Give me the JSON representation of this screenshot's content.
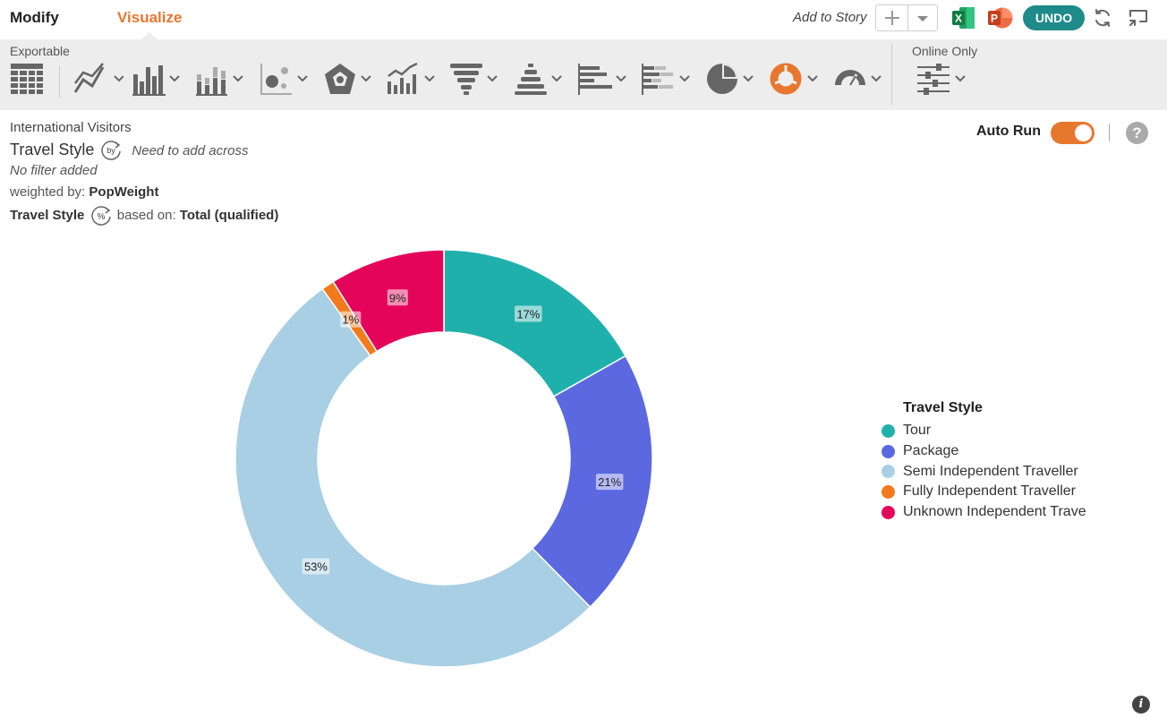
{
  "topbar": {
    "tabs": [
      "Modify",
      "Visualize"
    ],
    "add_to_story": "Add to Story",
    "undo": "UNDO",
    "excel_letter": "X",
    "ppt_letter": "P"
  },
  "toolbar": {
    "exportable_label": "Exportable",
    "online_only_label": "Online Only",
    "icons": [
      "table-icon",
      "line-chart-icon",
      "bar-chart-icon",
      "stacked-bar-icon",
      "scatter-icon",
      "radar-icon",
      "combo-chart-icon",
      "funnel-icon",
      "pyramid-icon",
      "horizontal-bar-icon",
      "horizontal-stacked-icon",
      "pie-icon",
      "donut-icon",
      "gauge-icon",
      "sliders-icon"
    ]
  },
  "info": {
    "dataset": "International Visitors",
    "row_variable": "Travel Style",
    "by_badge": "by",
    "across_note": "Need to add across",
    "filter": "No filter added",
    "weighted_label": "weighted by:",
    "weight": "PopWeight",
    "pct_variable": "Travel Style",
    "pct_badge": "%",
    "based_label": "based on:",
    "base": "Total (qualified)"
  },
  "autorun": {
    "label": "Auto Run",
    "on": true
  },
  "help": "?",
  "info_icon": "i",
  "chart_data": {
    "type": "pie",
    "variant": "donut",
    "legend_title": "Travel Style",
    "legend_position": "right",
    "categories": [
      "Tour",
      "Package",
      "Semi Independent Traveller",
      "Fully Independent Traveller",
      "Unknown Independent Trave"
    ],
    "values": [
      17,
      21,
      53,
      1,
      9
    ],
    "labels": [
      "17%",
      "21%",
      "53%",
      "1%",
      "9%"
    ],
    "colors": [
      "#20b0ac",
      "#5b68e0",
      "#a8cfe3",
      "#f37a1c",
      "#e4055a"
    ]
  }
}
